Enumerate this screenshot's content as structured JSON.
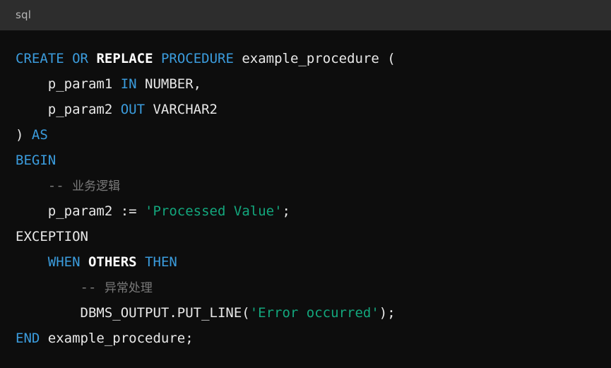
{
  "header": {
    "language_label": "sql"
  },
  "theme": {
    "header_background": "#2d2d2d",
    "code_background": "#0d0d0d",
    "keyword_color": "#3b9cdd",
    "plain_text_color": "#e8e8e8",
    "emphasis_text_color": "#ffffff",
    "string_color": "#13a77d",
    "comment_color": "#7a7a7a",
    "language_label_color": "#b6b6b6"
  },
  "code": {
    "language": "sql",
    "full_text": "CREATE OR REPLACE PROCEDURE example_procedure (\n    p_param1 IN NUMBER,\n    p_param2 OUT VARCHAR2\n) AS\nBEGIN\n    -- 业务逻辑\n    p_param2 := 'Processed Value';\nEXCEPTION\n    WHEN OTHERS THEN\n        -- 异常处理\n        DBMS_OUTPUT.PUT_LINE('Error occurred');\nEND example_procedure;",
    "lines": [
      {
        "indent": 0,
        "tokens": [
          {
            "text": "CREATE",
            "type": "keyword"
          },
          {
            "text": " ",
            "type": "plain"
          },
          {
            "text": "OR",
            "type": "keyword"
          },
          {
            "text": " ",
            "type": "plain"
          },
          {
            "text": "REPLACE",
            "type": "emphasis"
          },
          {
            "text": " ",
            "type": "plain"
          },
          {
            "text": "PROCEDURE",
            "type": "keyword"
          },
          {
            "text": " example_procedure (",
            "type": "plain"
          }
        ]
      },
      {
        "indent": 4,
        "tokens": [
          {
            "text": "p_param1 ",
            "type": "plain"
          },
          {
            "text": "IN",
            "type": "keyword"
          },
          {
            "text": " NUMBER,",
            "type": "plain"
          }
        ]
      },
      {
        "indent": 4,
        "tokens": [
          {
            "text": "p_param2 ",
            "type": "plain"
          },
          {
            "text": "OUT",
            "type": "keyword"
          },
          {
            "text": " VARCHAR2",
            "type": "plain"
          }
        ]
      },
      {
        "indent": 0,
        "tokens": [
          {
            "text": ") ",
            "type": "plain"
          },
          {
            "text": "AS",
            "type": "keyword"
          }
        ]
      },
      {
        "indent": 0,
        "tokens": [
          {
            "text": "BEGIN",
            "type": "keyword"
          }
        ]
      },
      {
        "indent": 4,
        "tokens": [
          {
            "text": "-- ",
            "type": "comment"
          },
          {
            "text": "业务逻辑",
            "type": "comment-cjk"
          }
        ]
      },
      {
        "indent": 4,
        "tokens": [
          {
            "text": "p_param2 := ",
            "type": "plain"
          },
          {
            "text": "'Processed Value'",
            "type": "string"
          },
          {
            "text": ";",
            "type": "plain"
          }
        ]
      },
      {
        "indent": 0,
        "tokens": [
          {
            "text": "EXCEPTION",
            "type": "plain"
          }
        ]
      },
      {
        "indent": 4,
        "tokens": [
          {
            "text": "WHEN",
            "type": "keyword"
          },
          {
            "text": " ",
            "type": "plain"
          },
          {
            "text": "OTHERS",
            "type": "emphasis"
          },
          {
            "text": " ",
            "type": "plain"
          },
          {
            "text": "THEN",
            "type": "keyword"
          }
        ]
      },
      {
        "indent": 8,
        "tokens": [
          {
            "text": "-- ",
            "type": "comment"
          },
          {
            "text": "异常处理",
            "type": "comment-cjk"
          }
        ]
      },
      {
        "indent": 8,
        "tokens": [
          {
            "text": "DBMS_OUTPUT.PUT_LINE(",
            "type": "plain"
          },
          {
            "text": "'Error occurred'",
            "type": "string"
          },
          {
            "text": ");",
            "type": "plain"
          }
        ]
      },
      {
        "indent": 0,
        "tokens": [
          {
            "text": "END",
            "type": "keyword"
          },
          {
            "text": " example_procedure;",
            "type": "plain"
          }
        ]
      }
    ]
  }
}
